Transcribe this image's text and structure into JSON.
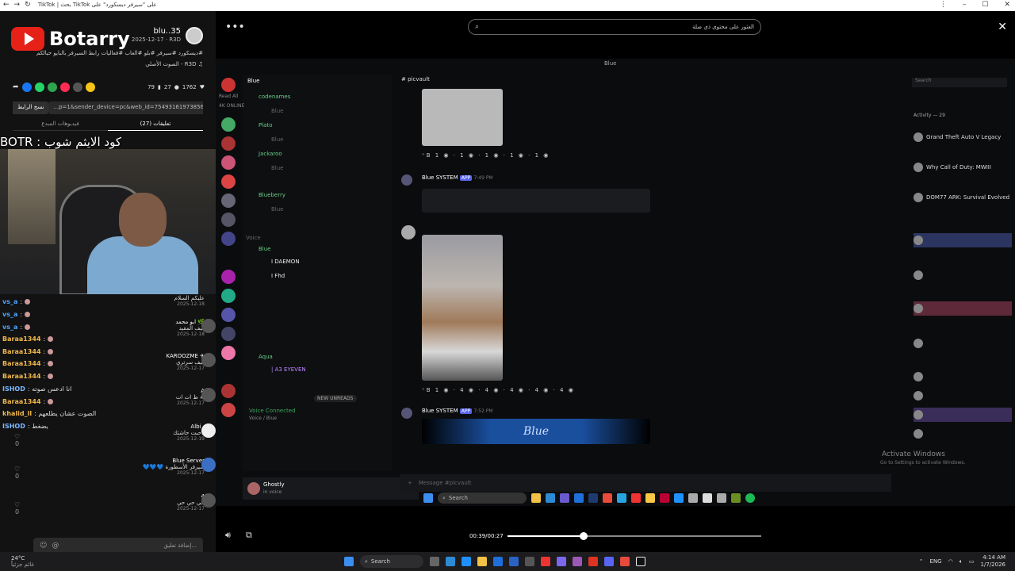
{
  "browser": {
    "tab_title": "TikTok | بحث TikTok على \"سيرفر ديسكورد\" على"
  },
  "profile": {
    "logo_text": "Botarry",
    "username": "blu..35",
    "date": "2025-12-17 · R3D",
    "hashtags": "#ديسكورد #سيرفر #بلو #العاب #فعاليات رابط السيرفر بالبايو حيالكم",
    "sound": "الصوت الأصلي - R3D ♫",
    "likes": "1762",
    "comments_count": "27",
    "saves": "79",
    "link_url": "...p=1&sender_device=pc&web_id=7549316197385651730",
    "copy_label": "نسخ الرابط",
    "tab_comments": "تعليقات (27)",
    "tab_creator_videos": "فيديوهات المبدع",
    "comment_placeholder": "إضافة تعليق..."
  },
  "overlay_text": "BOTR : كود الايثم شوب",
  "chat": [
    {
      "name": "vs_a",
      "text": ":",
      "color": "#4fa6ff"
    },
    {
      "name": "vs_a",
      "text": ":",
      "color": "#4fa6ff"
    },
    {
      "name": "vs_a",
      "text": ":",
      "color": "#4fa6ff"
    },
    {
      "name": "Baraa1344",
      "text": ":",
      "color": "#f0b84a"
    },
    {
      "name": "Baraa1344",
      "text": ":",
      "color": "#f0b84a"
    },
    {
      "name": "Baraa1344",
      "text": ":",
      "color": "#f0b84a"
    },
    {
      "name": "Baraa1344",
      "text": ":",
      "color": "#f0b84a"
    },
    {
      "name": "ISHOD",
      "text": ": انا ادعس صوته",
      "color": "#7ab8ff"
    },
    {
      "name": "Baraa1344",
      "text": ":",
      "color": "#f0b84a"
    },
    {
      "name": "khalid_ll",
      "text": ": الصوت عشان يطلعهم",
      "color": "#f0b84a"
    },
    {
      "name": "ISHOD",
      "text": ": يضغط",
      "color": "#7ab8ff"
    }
  ],
  "comments": [
    {
      "name": "",
      "text": "عليكم السلام",
      "date": "2025-12-18"
    },
    {
      "name": "ابو محمد 🌿",
      "text": "كيف المقيد",
      "date": "2025-12-18"
    },
    {
      "name": "KAROOZME ✈",
      "text": "كيف سرتري",
      "date": "2025-12-17"
    },
    {
      "name": "A",
      "text": "# ظ ات ات",
      "date": "2025-12-17"
    },
    {
      "name": "Albi .",
      "text": "لاحبت حاشتك",
      "date": "2025-12-19"
    },
    {
      "name": "Blue Server",
      "text": "سيرفر الأسطورة 💙💙💙",
      "date": "2025-12-17"
    },
    {
      "name": "4",
      "text": "حي حي حي",
      "date": "2025-12-17"
    }
  ],
  "likes_counts": [
    "0",
    "0",
    "0",
    "0"
  ],
  "search": {
    "placeholder": "العثور على محتوى ذي صلة"
  },
  "discord": {
    "window_title": "Blue",
    "server_name": "Blue",
    "channel_name": "picvault",
    "search_placeholder": "Search",
    "online_label": "4K ONLINE",
    "read_all": "Read All",
    "channels": [
      "codenames",
      "Blue",
      "Plato",
      "Blue",
      "Jackaroo",
      "Blue",
      "Blueberry",
      "Blue",
      "Voice",
      "Blue",
      "I DAEMON",
      "I Fhd",
      "Aqua",
      "| A3 EYEVEN",
      "Blue"
    ],
    "new_unreads": "NEW UNREADS",
    "voice_connected": "Voice Connected",
    "voice_sub": "Voice / Blue",
    "user_name": "Ghostly",
    "user_status": "in voice",
    "msg_author": "Blue SYSTEM",
    "app_tag": "APP",
    "msg_time1": "7:49 PM",
    "msg_time2": "7:52 PM",
    "banner_text": "Blue",
    "message_placeholder": "Message #picvault",
    "activity_title": "Activity — 29",
    "games": [
      "Grand Theft Auto V Legacy",
      "Why Call of Duty: MWIII",
      "DOM77 ARK: Survival Evolved"
    ],
    "activate_windows": "Activate Windows",
    "activate_sub": "Go to Settings to activate Windows.",
    "taskbar_search": "Search"
  },
  "player": {
    "time": "00:39/00:27",
    "progress": 0.3
  },
  "taskbar": {
    "weather_temp": "24°C",
    "weather_desc": "غائم جزئياً",
    "search": "Search",
    "lang": "ENG",
    "time": "4:14 AM",
    "date": "1/7/2026"
  }
}
